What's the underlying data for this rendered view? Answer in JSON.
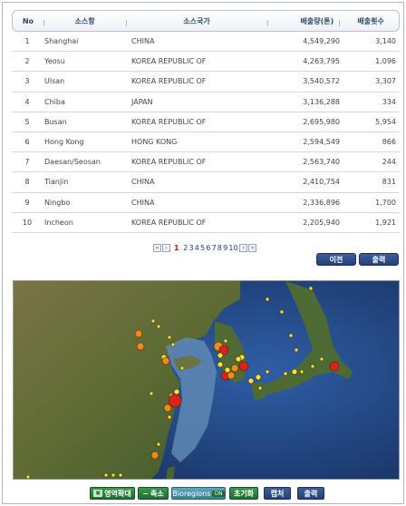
{
  "table": {
    "headers": {
      "no": "No",
      "port": "소스항",
      "country": "소스국가",
      "volume": "배출량(톤)",
      "count": "배출횟수"
    },
    "rows": [
      {
        "no": "1",
        "port": "Shanghai",
        "country": "CHINA",
        "volume": "4,549,290",
        "count": "3,140"
      },
      {
        "no": "2",
        "port": "Yeosu",
        "country": "KOREA REPUBLIC OF",
        "volume": "4,263,795",
        "count": "1,096"
      },
      {
        "no": "3",
        "port": "Ulsan",
        "country": "KOREA REPUBLIC OF",
        "volume": "3,540,572",
        "count": "3,307"
      },
      {
        "no": "4",
        "port": "Chiba",
        "country": "JAPAN",
        "volume": "3,136,288",
        "count": "334"
      },
      {
        "no": "5",
        "port": "Busan",
        "country": "KOREA REPUBLIC OF",
        "volume": "2,695,980",
        "count": "5,954"
      },
      {
        "no": "6",
        "port": "Hong Kong",
        "country": "HONG KONG",
        "volume": "2,594,549",
        "count": "866"
      },
      {
        "no": "7",
        "port": "Daesan/Seosan",
        "country": "KOREA REPUBLIC OF",
        "volume": "2,563,740",
        "count": "244"
      },
      {
        "no": "8",
        "port": "Tianjin",
        "country": "CHINA",
        "volume": "2,410,754",
        "count": "831"
      },
      {
        "no": "9",
        "port": "Ningbo",
        "country": "CHINA",
        "volume": "2,336,896",
        "count": "1,700"
      },
      {
        "no": "10",
        "port": "Incheon",
        "country": "KOREA REPUBLIC OF",
        "volume": "2,205,940",
        "count": "1,921"
      }
    ]
  },
  "pagination": {
    "first": "«",
    "prev": "‹",
    "next": "›",
    "last": "»",
    "current": "1",
    "pages": [
      "2",
      "3",
      "4",
      "5",
      "6",
      "7",
      "8",
      "9",
      "10"
    ]
  },
  "actions": {
    "prev_label": "이전",
    "output_label": "출력"
  },
  "toolbar": {
    "zoom_in": "영역확대",
    "zoom_out": "축소",
    "bioregions": "Bioregions",
    "bioregions_state": "ON",
    "reset": "초기화",
    "capture": "캡처",
    "print": "출력"
  },
  "colors": {
    "accent_navy": "#23407a",
    "accent_green": "#1f6e2f",
    "marker_red": "#e0201a",
    "marker_orange": "#f08a1a",
    "marker_yellow": "#f4e23a"
  }
}
